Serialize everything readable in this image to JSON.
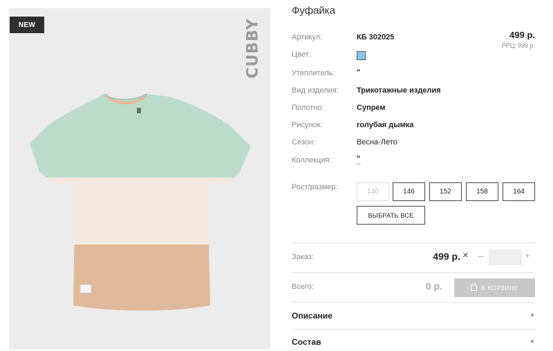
{
  "product": {
    "badge": "NEW",
    "brand": "CUBBY",
    "title": "Фуфайка",
    "price": "499 р.",
    "rrp_label": "РРЦ:",
    "rrp_value": "999 р."
  },
  "attributes": [
    {
      "label": "Артикул:",
      "value": "КБ 302025"
    },
    {
      "label": "Цвет:",
      "value": "",
      "swatch_color": "#8cc4ef"
    },
    {
      "label": "Утеплитель:",
      "value": "\""
    },
    {
      "label": "Вид изделия:",
      "value": "Трикотажные изделия"
    },
    {
      "label": "Полотно:",
      "value": "Супрем"
    },
    {
      "label": "Рисунок:",
      "value": "голубая дымка"
    },
    {
      "label": "Сезон:",
      "value": "Весна-Лето"
    },
    {
      "label": "Коллекция:",
      "value": "\""
    }
  ],
  "sizes": {
    "label": "Рост/размер:",
    "options": [
      "140",
      "146",
      "152",
      "158",
      "164"
    ],
    "disabled": [
      "140"
    ],
    "select_all": "ВЫБРАТЬ ВСЕ"
  },
  "order": {
    "label": "Заказ:",
    "price": "499 р.",
    "multiply": "×",
    "minus": "–",
    "quantity": "",
    "plus": "+"
  },
  "total": {
    "label": "Всего:",
    "value": "0 р.",
    "cart_button": "В КОРЗИНУ"
  },
  "accordion": [
    {
      "label": "Описание"
    },
    {
      "label": "Состав"
    }
  ],
  "icons": {
    "cart": "shopping-bag-icon",
    "accordion": "triangle-down-icon"
  },
  "colors": {
    "badge_bg": "#2f2f2f",
    "cart_disabled": "#c8c8c8",
    "shirt_top": "#bcdccb",
    "shirt_mid": "#f5e8df",
    "shirt_bottom": "#dfb99a"
  }
}
